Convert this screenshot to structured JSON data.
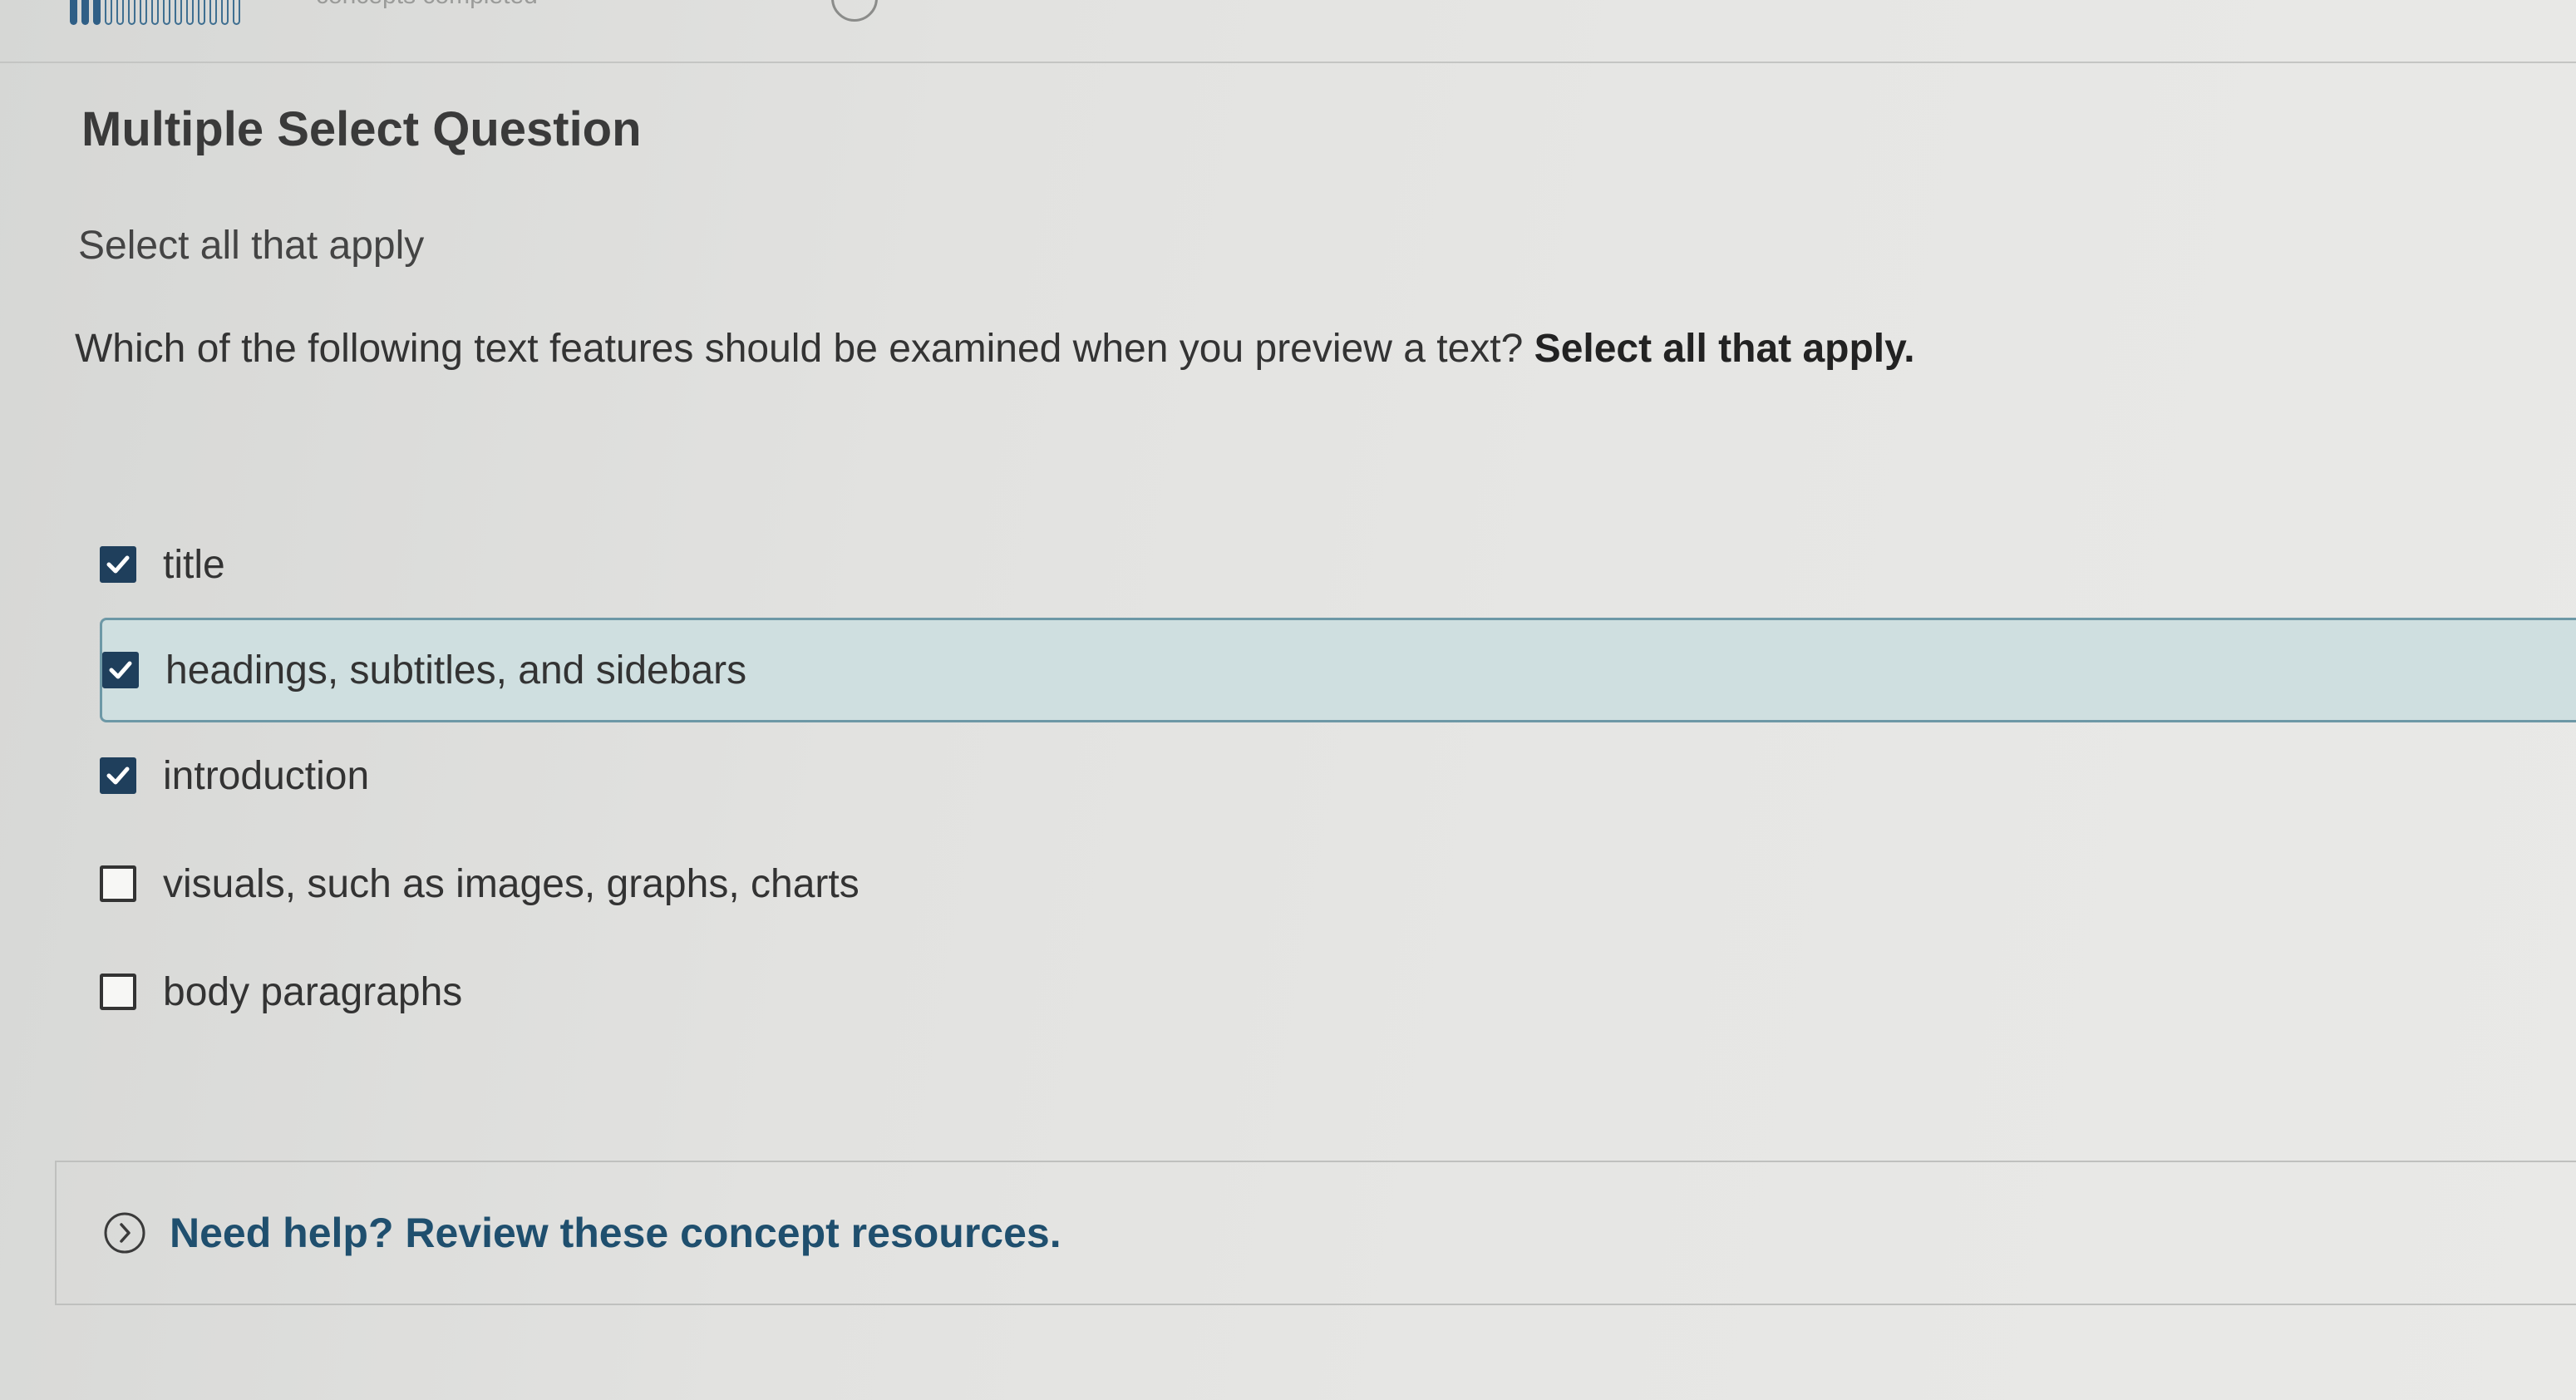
{
  "progress": {
    "filled_segments": 3,
    "total_segments": 15,
    "label": "concepts completed"
  },
  "question": {
    "type": "Multiple Select Question",
    "instruction": "Select all that apply",
    "prompt": "Which of the following text features should be examined when you preview a text?",
    "prompt_emphasis": "Select all that apply."
  },
  "options": [
    {
      "label": "title",
      "checked": true,
      "highlighted": false
    },
    {
      "label": "headings, subtitles, and sidebars",
      "checked": true,
      "highlighted": true
    },
    {
      "label": "introduction",
      "checked": true,
      "highlighted": false
    },
    {
      "label": "visuals, such as images, graphs, charts",
      "checked": false,
      "highlighted": false
    },
    {
      "label": "body paragraphs",
      "checked": false,
      "highlighted": false
    }
  ],
  "help": {
    "text": "Need help? Review these concept resources.",
    "icon": "chevron-right-circle-icon"
  },
  "colors": {
    "accent": "#1f4f6e",
    "checkbox_checked": "#1f3f5c",
    "highlight_bg": "#cfdfe0",
    "highlight_border": "#6d98a6",
    "progress_fill": "#2f5f86"
  }
}
